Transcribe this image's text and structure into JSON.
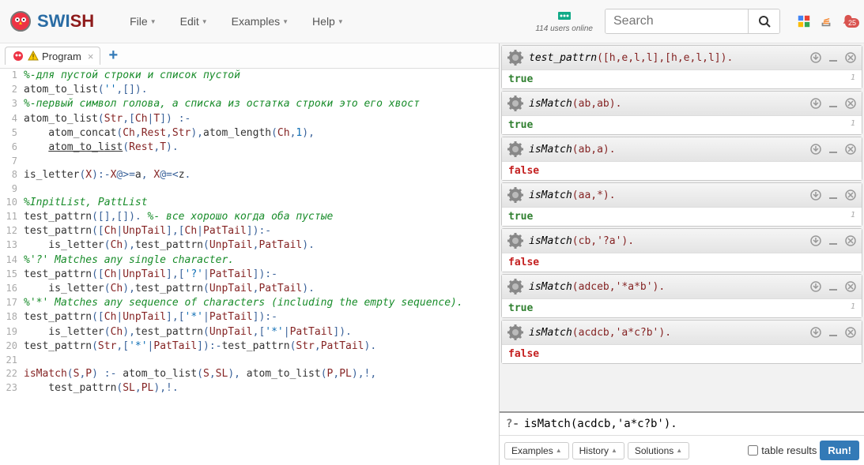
{
  "brand": {
    "swi": "SWI",
    "sh": "SH"
  },
  "menu": {
    "file": "File",
    "edit": "Edit",
    "examples": "Examples",
    "help": "Help"
  },
  "users_online": "114 users online",
  "search": {
    "placeholder": "Search"
  },
  "notifications": "25",
  "tab": {
    "label": "Program"
  },
  "code": [
    {
      "n": "1",
      "type": "cm",
      "t": "%-для пустой строки и список пустой"
    },
    {
      "n": "2",
      "type": "p",
      "t": "atom_to_list('',[])."
    },
    {
      "n": "3",
      "type": "cm",
      "t": "%-первый символ голова, а списка из остатка строки это его хвост"
    },
    {
      "n": "4",
      "type": "p",
      "t": "atom_to_list(Str,[Ch|T]) :-"
    },
    {
      "n": "5",
      "type": "p",
      "t": "    atom_concat(Ch,Rest,Str),atom_length(Ch,1),"
    },
    {
      "n": "6",
      "type": "p",
      "t": "    atom_to_list(Rest,T).",
      "ul": true
    },
    {
      "n": "7",
      "type": "p",
      "t": ""
    },
    {
      "n": "8",
      "type": "p",
      "t": "is_letter(X):-X@>=a, X@=<z."
    },
    {
      "n": "9",
      "type": "p",
      "t": ""
    },
    {
      "n": "10",
      "type": "cm",
      "t": "%InpitList, PattList"
    },
    {
      "n": "11",
      "type": "mix",
      "t": "test_pattrn([],[]). ",
      "cm": "%- все хорошо когда оба пустые"
    },
    {
      "n": "12",
      "type": "p",
      "t": "test_pattrn([Ch|UnpTail],[Ch|PatTail]):-"
    },
    {
      "n": "13",
      "type": "p",
      "t": "    is_letter(Ch),test_pattrn(UnpTail,PatTail).",
      "ul2": "test_pattrn"
    },
    {
      "n": "14",
      "type": "cm",
      "t": "%'?' Matches any single character."
    },
    {
      "n": "15",
      "type": "p",
      "t": "test_pattrn([Ch|UnpTail],['?'|PatTail]):-"
    },
    {
      "n": "16",
      "type": "p",
      "t": "    is_letter(Ch),test_pattrn(UnpTail,PatTail).",
      "ul2": "test_pattrn"
    },
    {
      "n": "17",
      "type": "cm",
      "t": "%'*' Matches any sequence of characters (including the empty sequence)."
    },
    {
      "n": "18",
      "type": "p",
      "t": "test_pattrn([Ch|UnpTail],['*'|PatTail]):-"
    },
    {
      "n": "19",
      "type": "p",
      "t": "    is_letter(Ch),test_pattrn(UnpTail,['*'|PatTail]).",
      "ul2": "test_pattrn"
    },
    {
      "n": "20",
      "type": "p",
      "t": "test_pattrn(Str,['*'|PatTail]):-test_pattrn(Str,PatTail).",
      "ul2": "test_pattrn"
    },
    {
      "n": "21",
      "type": "p",
      "t": ""
    },
    {
      "n": "22",
      "type": "p2",
      "head": "isMatch",
      "t": "(S,P) :- atom_to_list(S,SL), atom_to_list(P,PL),!,"
    },
    {
      "n": "23",
      "type": "p",
      "t": "    test_pattrn(SL,PL),!."
    }
  ],
  "queries": [
    {
      "pred": "test_pattrn",
      "args": "([h,e,l,l],[h,e,l,l]).",
      "result": "true",
      "idx": "1"
    },
    {
      "pred": "isMatch",
      "args": "(ab,ab).",
      "result": "true",
      "idx": "1"
    },
    {
      "pred": "isMatch",
      "args": "(ab,a).",
      "result": "false",
      "idx": ""
    },
    {
      "pred": "isMatch",
      "args": "(aa,*).",
      "result": "true",
      "idx": "1"
    },
    {
      "pred": "isMatch",
      "args": "(cb,'?a').",
      "result": "false",
      "idx": ""
    },
    {
      "pred": "isMatch",
      "args": "(adceb,'*a*b').",
      "result": "true",
      "idx": "1"
    },
    {
      "pred": "isMatch",
      "args": "(acdcb,'a*c?b').",
      "result": "false",
      "idx": ""
    }
  ],
  "repl": {
    "prompt": "?-",
    "input": "isMatch(acdcb,'a*c?b')."
  },
  "footer": {
    "examples": "Examples",
    "history": "History",
    "solutions": "Solutions",
    "table": "table results",
    "run": "Run!"
  }
}
